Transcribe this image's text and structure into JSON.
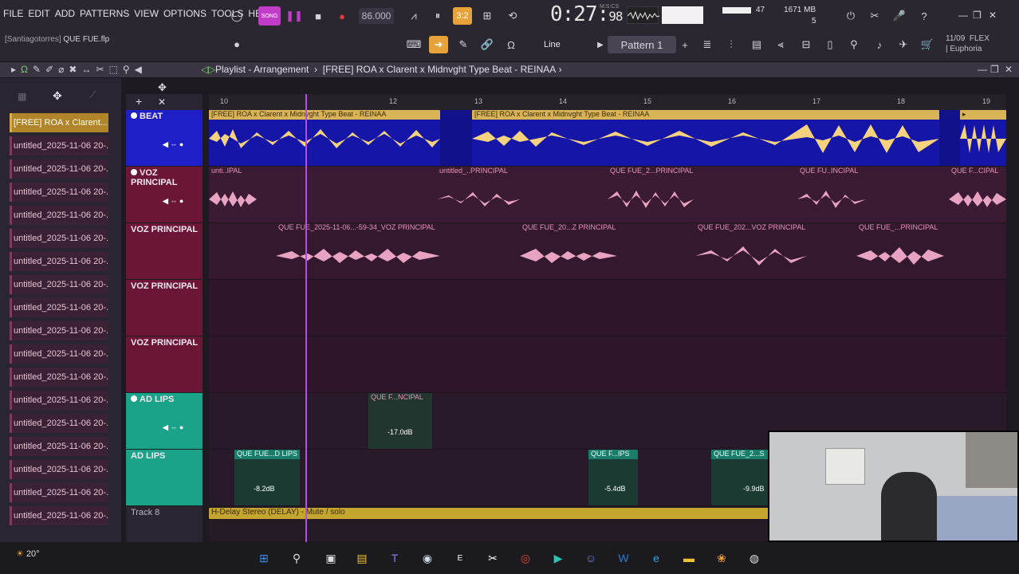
{
  "menu": [
    "FILE",
    "EDIT",
    "ADD",
    "PATTERNS",
    "VIEW",
    "OPTIONS",
    "TOOLS",
    "HELP"
  ],
  "file": {
    "user": "[Santiagotorres]",
    "name": "QUE FUE.flp"
  },
  "transport": {
    "mode": "SONG",
    "tempo": "86.000",
    "time_main": "0:27",
    "time_frac": "98",
    "time_label": "M:S:CS",
    "beat_display": "3:2"
  },
  "cpu": {
    "value": "47",
    "memory": "1671 MB",
    "polyphony": "5"
  },
  "toolbar": {
    "snap": "Line",
    "pattern": "Pattern 1",
    "flex_date": "11/09",
    "flex_label": "FLEX",
    "flex_preset": "| Euphoria"
  },
  "playlist": {
    "title_prefix": "Playlist - Arrangement",
    "title": "[FREE] ROA x Clarent x Midnvght Type Beat - REINAA",
    "ruler": [
      "10",
      "12",
      "13",
      "14",
      "15",
      "16",
      "17",
      "18",
      "19"
    ]
  },
  "sidebar": {
    "items": [
      "[FREE] ROA x Clarent...",
      "untitled_2025-11-06 20-...",
      "untitled_2025-11-06 20-...",
      "untitled_2025-11-06 20-...",
      "untitled_2025-11-06 20-...",
      "untitled_2025-11-06 20-...",
      "untitled_2025-11-06 20-...",
      "untitled_2025-11-06 20-...",
      "untitled_2025-11-06 20-...",
      "untitled_2025-11-06 20-...",
      "untitled_2025-11-06 20-...",
      "untitled_2025-11-06 20-...",
      "untitled_2025-11-06 20-...",
      "untitled_2025-11-06 20-...",
      "untitled_2025-11-06 20-...",
      "untitled_2025-11-06 20-...",
      "untitled_2025-11-06 20-...",
      "untitled_2025-11-06 20-..."
    ]
  },
  "tracks": [
    {
      "name": "BEAT"
    },
    {
      "name": "VOZ PRINCIPAL"
    },
    {
      "name": "VOZ PRINCIPAL"
    },
    {
      "name": "VOZ PRINCIPAL"
    },
    {
      "name": "VOZ PRINCIPAL"
    },
    {
      "name": "AD LIPS"
    },
    {
      "name": "AD LIPS"
    },
    {
      "name": "Track 8"
    }
  ],
  "clips": {
    "beat_a": "[FREE] ROA x Clarent x Midnvght Type Beat - REINAA",
    "beat_b": "[FREE] ROA x Clarent x Midnvght Type Beat - REINAA",
    "v1_a": "unti..IPAL",
    "v1_b": "untitled_..PRINCIPAL",
    "v1_c": "QUE FUE_2...PRINCIPAL",
    "v1_d": "QUE FU..INCIPAL",
    "v1_e": "QUE F...CIPAL",
    "v2_a": "QUE FUE_2025-11-06...-59-34_VOZ PRINCIPAL",
    "v2_b": "QUE FUE_20...Z PRINCIPAL",
    "v2_c": "QUE FUE_202...VOZ PRINCIPAL",
    "v2_d": "QUE FUE_...PRINCIPAL",
    "ad1": "QUE F...NCIPAL",
    "ad1_vol": "-17.0dB",
    "ad2_a": "QUE FUE...D LIPS",
    "ad2_a_vol": "-8.2dB",
    "ad2_b": "QUE F...IPS",
    "ad2_b_vol": "-5.4dB",
    "ad2_c": "QUE FUE_2...S",
    "ad2_c_vol": "-9.9dB",
    "automation": "H-Delay Stereo (DELAY) - Mute / solo"
  },
  "taskbar": {
    "temp": "20°"
  }
}
